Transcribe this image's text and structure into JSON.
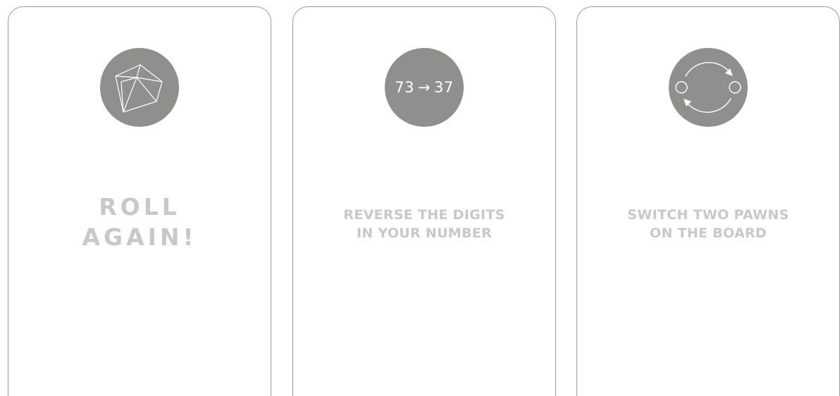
{
  "cards": [
    {
      "icon": "die-icon",
      "lines": [
        "ROLL",
        "AGAIN!"
      ]
    },
    {
      "icon": "reverse-digits-icon",
      "emblem": {
        "from": "73",
        "arrow": "→",
        "to": "37"
      },
      "lines": [
        "REVERSE THE DIGITS",
        "IN YOUR NUMBER"
      ]
    },
    {
      "icon": "swap-pawns-icon",
      "lines": [
        "SWITCH TWO PAWNS",
        "ON THE BOARD"
      ]
    }
  ],
  "colors": {
    "card_border": "#9a9a9a",
    "emblem_fill": "#8f8f8e",
    "text": "#c8c8cb",
    "emblem_line": "#ffffff"
  }
}
